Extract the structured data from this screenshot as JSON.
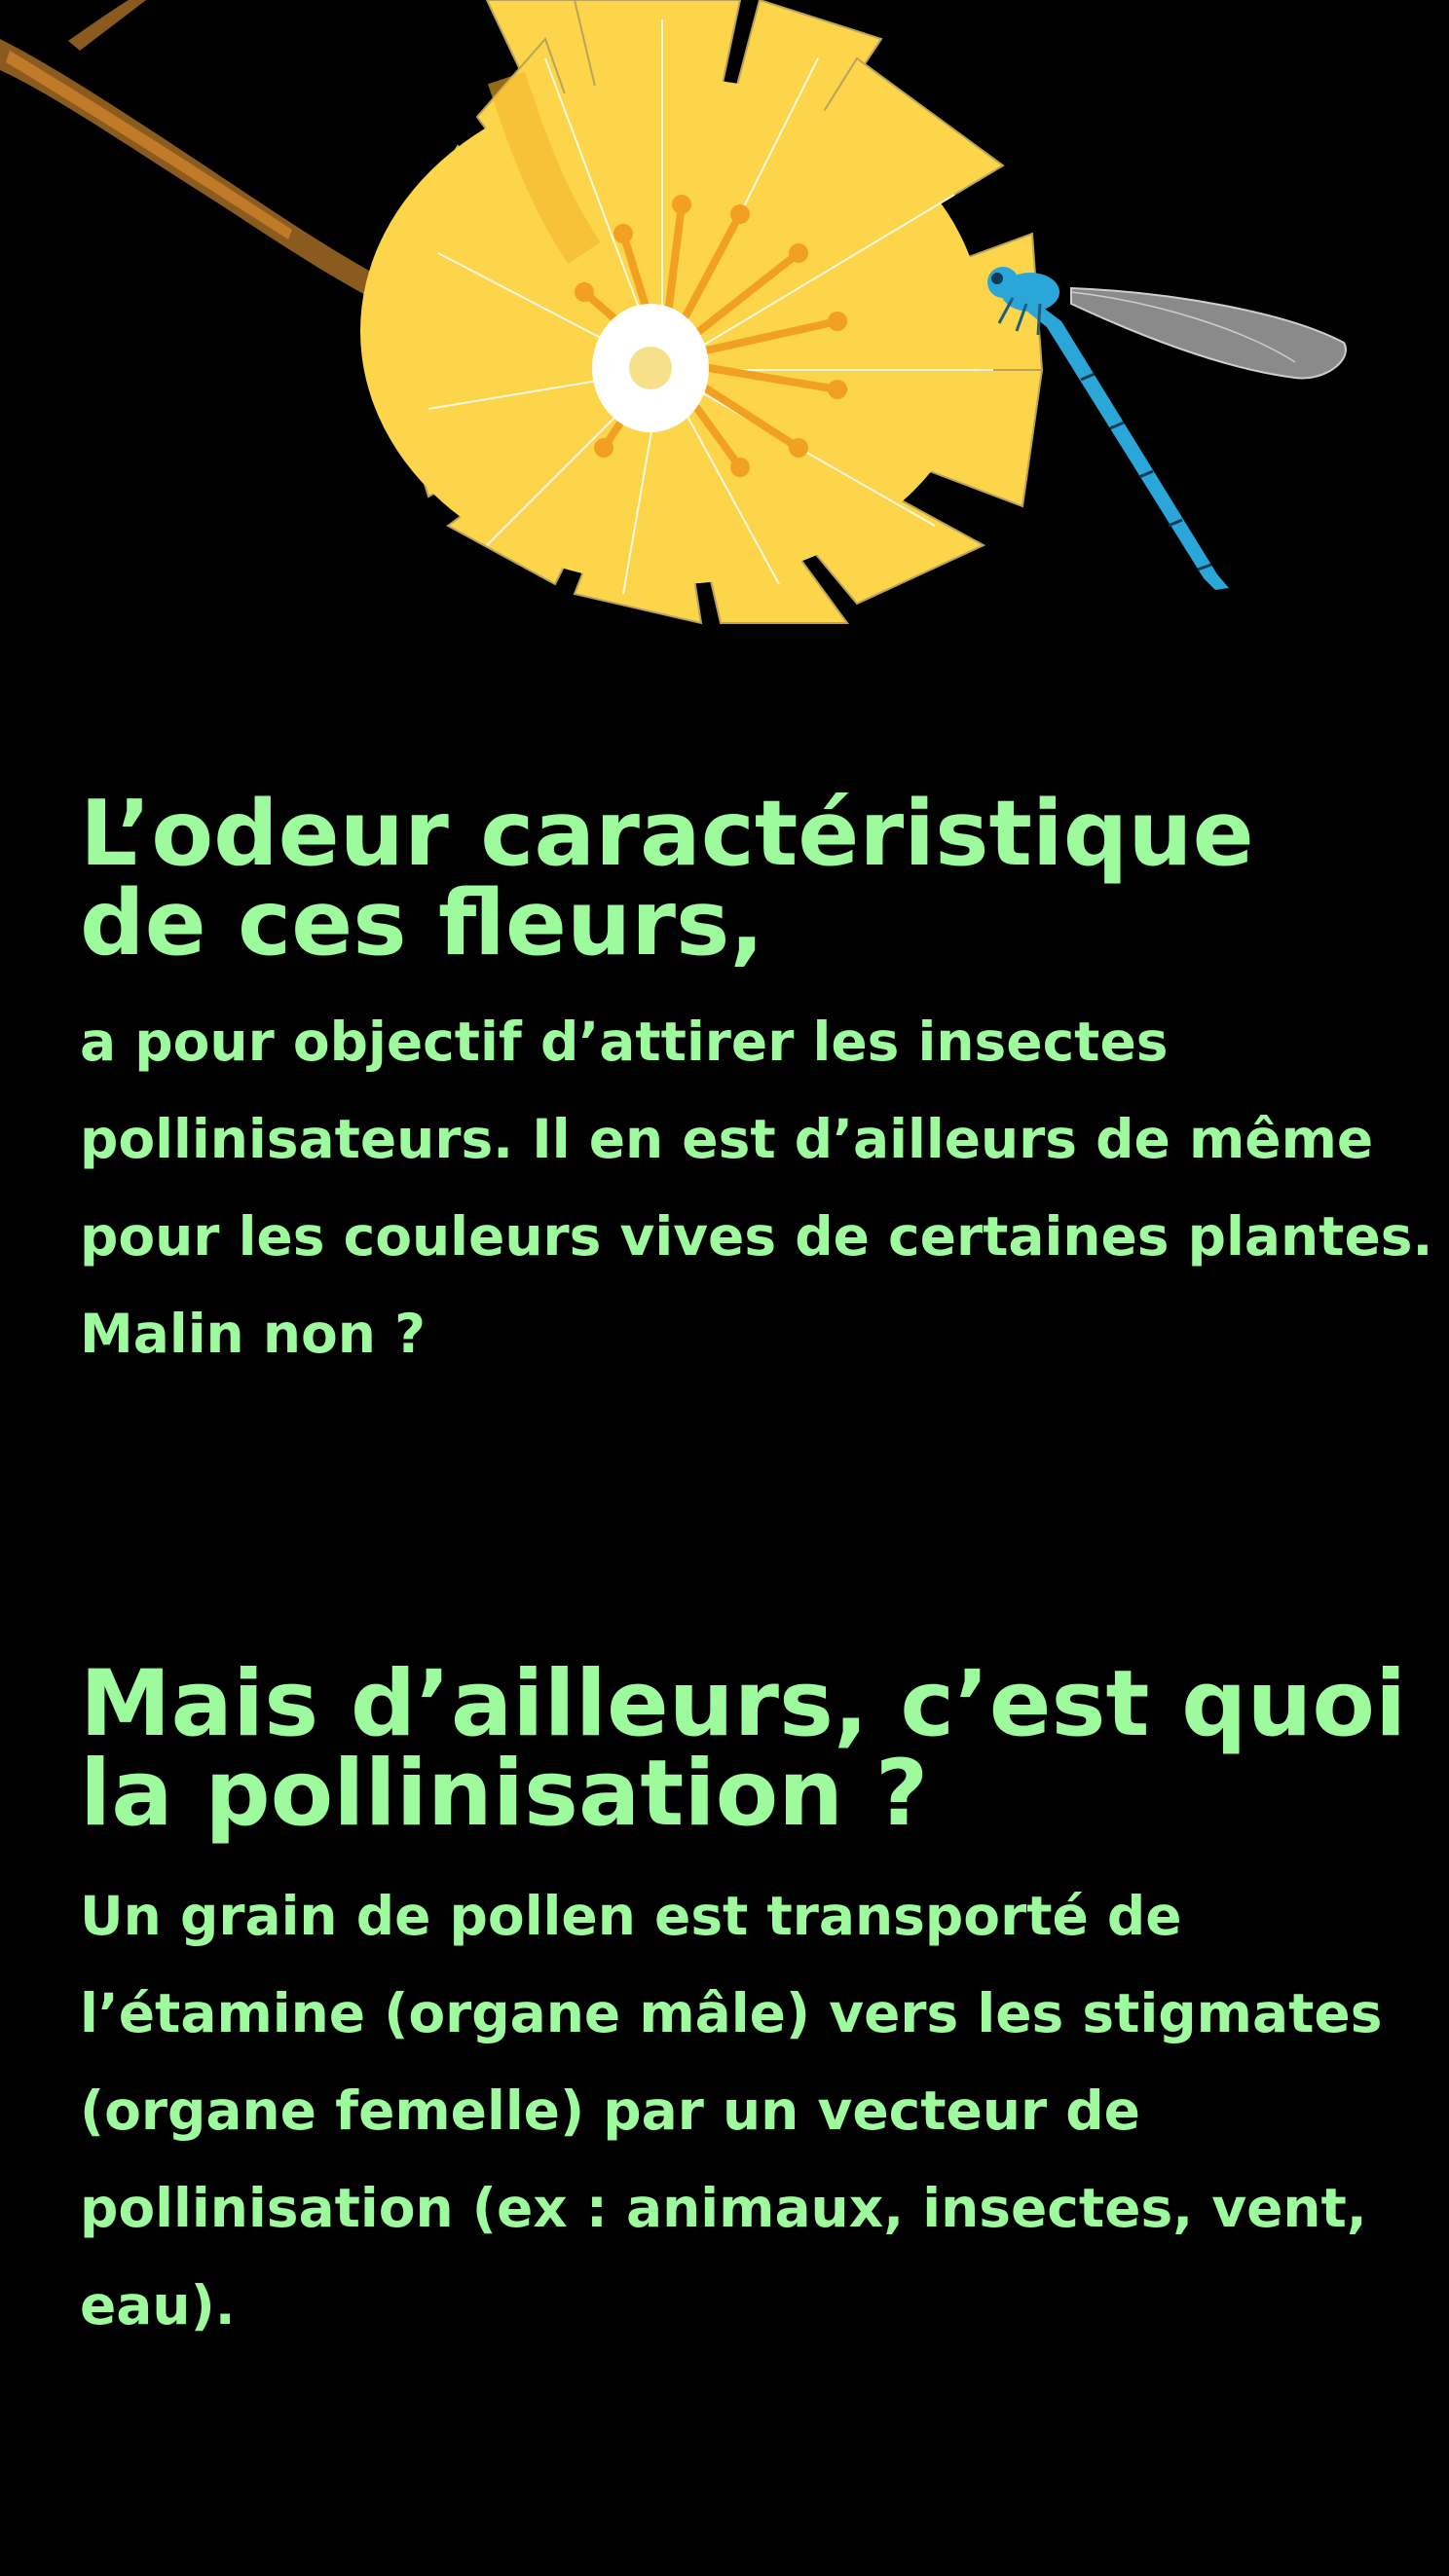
{
  "colors": {
    "background": "#000000",
    "text": "#9dfa9d",
    "petal": "#fcd54b",
    "petal_shade": "#f4b62a",
    "stamen": "#f2a020",
    "branch": "#8b5a1e",
    "dragonfly_body": "#2aa6d8"
  },
  "illustration": {
    "elements": [
      "branch",
      "yellow-flower",
      "dragonfly"
    ]
  },
  "section1": {
    "heading_lines": [
      "L’odeur  caractéristique",
      "de ces fleurs,"
    ],
    "body_lines": [
      "a pour objectif d’attirer les insectes",
      "pollinisateurs. Il en est d’ailleurs de même",
      "pour les couleurs vives de certaines plantes.",
      "Malin non ?"
    ]
  },
  "section2": {
    "heading_lines": [
      "Mais d’ailleurs, c’est quoi",
      "la pollinisation ?"
    ],
    "body_lines": [
      "Un grain de pollen est transporté de",
      "l’étamine (organe mâle) vers les stigmates",
      "(organe femelle) par un vecteur de",
      "pollinisation (ex : animaux, insectes, vent,",
      "eau)."
    ]
  }
}
